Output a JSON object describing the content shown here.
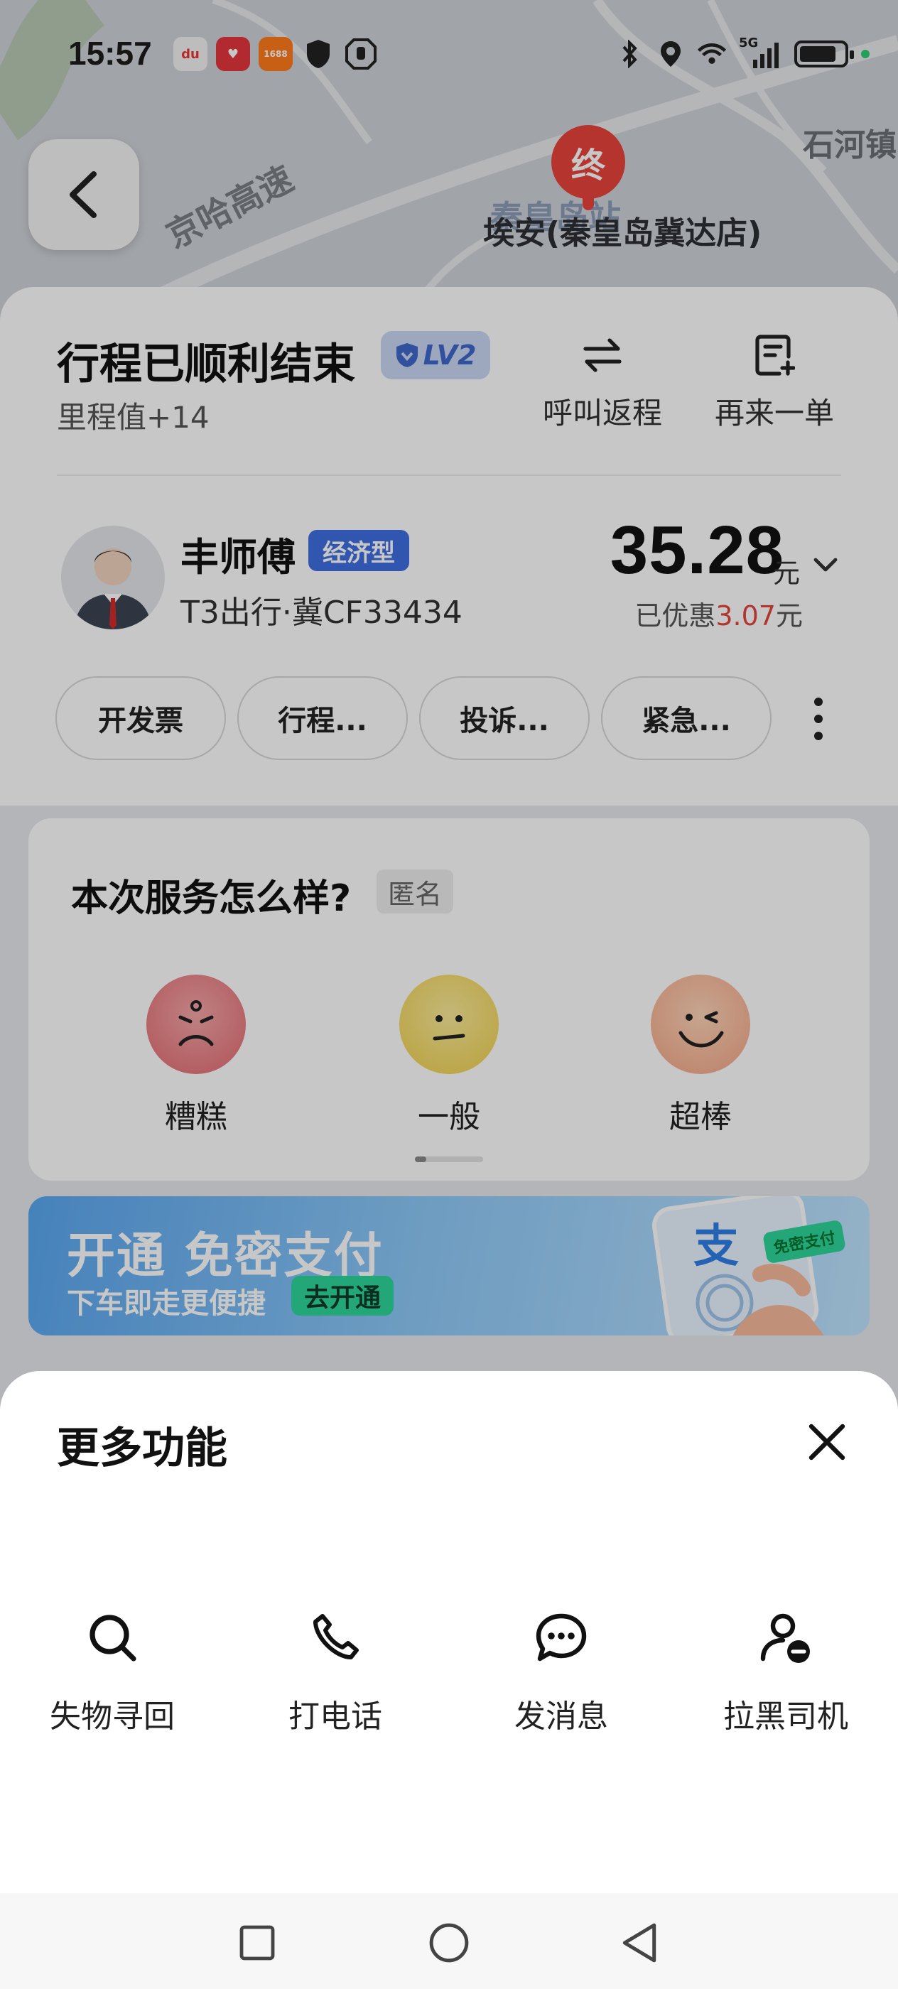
{
  "status_bar": {
    "time": "15:57",
    "app_icons": [
      "du-app-icon",
      "heart-app-icon",
      "1688-app-icon",
      "shield-icon",
      "hand-icon"
    ],
    "app_icon_1688_label": "1688",
    "right_icons": [
      "bluetooth-icon",
      "location-icon",
      "wifi-icon",
      "5g-signal-icon",
      "battery-icon"
    ],
    "network": "5G"
  },
  "map": {
    "highway_label": "京哈高速",
    "town_label": "石河镇",
    "station_label": "秦皇岛站",
    "end_pin_label": "终",
    "poi_label": "埃安(秦皇岛冀达店)"
  },
  "trip": {
    "title": "行程已顺利结束",
    "level_badge": "LV2",
    "mileage": "里程值+14",
    "actions": [
      {
        "label": "呼叫返程",
        "icon": "swap-arrows-icon"
      },
      {
        "label": "再来一单",
        "icon": "new-order-icon"
      }
    ]
  },
  "driver": {
    "name": "丰师傅",
    "car_type": "经济型",
    "plate": "T3出行·冀CF33434"
  },
  "fare": {
    "amount": "35.28",
    "unit": "元",
    "discount_prefix": "已优惠",
    "discount_value": "3.07",
    "discount_unit": "元"
  },
  "chips": [
    "开发票",
    "行程...",
    "投诉...",
    "紧急..."
  ],
  "rating": {
    "question": "本次服务怎么样?",
    "anonymous": "匿名",
    "options": [
      "糟糕",
      "一般",
      "超棒"
    ]
  },
  "banner": {
    "title": "开通 免密支付",
    "subtitle": "下车即走更便捷",
    "cta": "去开通",
    "tag": "免密支付",
    "art_glyph": "支"
  },
  "sheet": {
    "title": "更多功能",
    "functions": [
      {
        "label": "失物寻回",
        "icon": "search-icon"
      },
      {
        "label": "打电话",
        "icon": "phone-icon"
      },
      {
        "label": "发消息",
        "icon": "message-icon"
      },
      {
        "label": "拉黑司机",
        "icon": "block-user-icon"
      }
    ]
  },
  "colors": {
    "accent_blue": "#3f6fe0",
    "discount_red": "#e3463a",
    "end_pin_red": "#e8453c",
    "cta_green": "#2fd69a"
  }
}
